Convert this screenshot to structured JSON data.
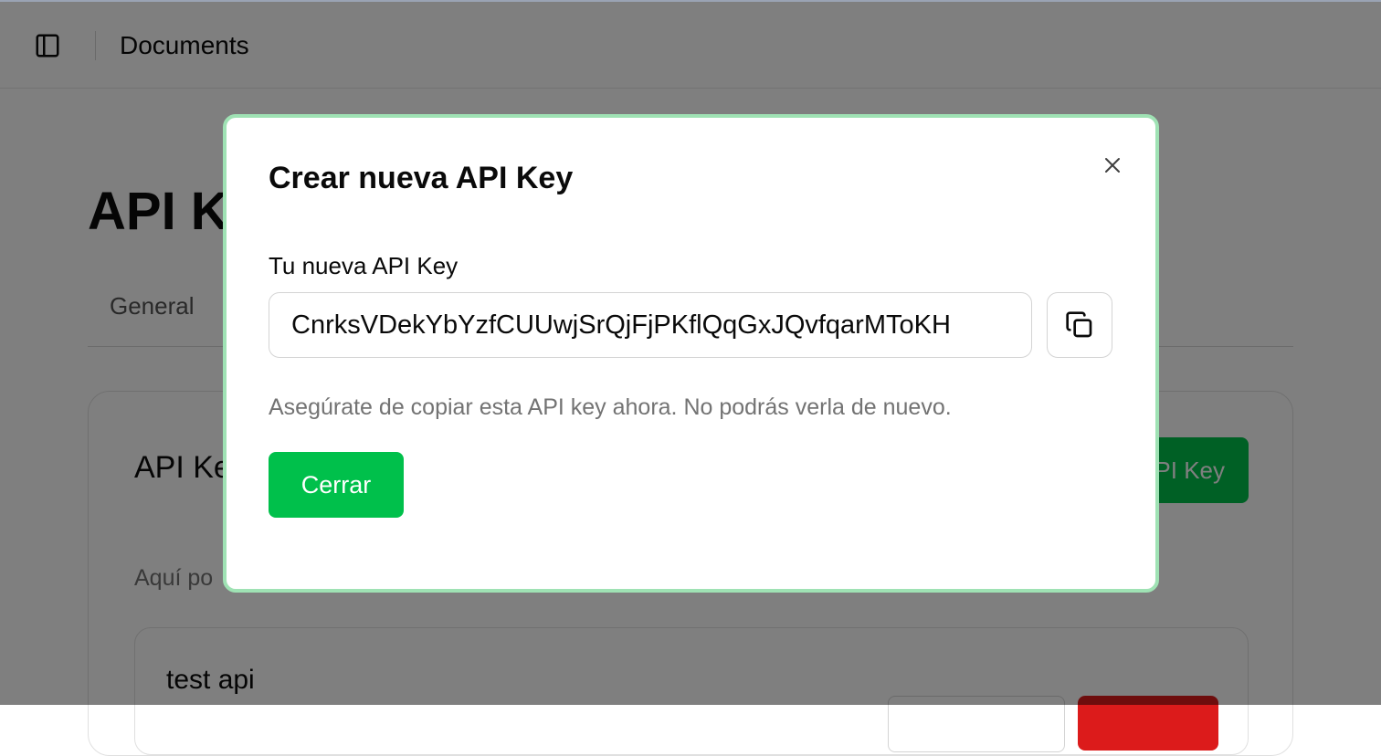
{
  "topbar": {
    "title": "Documents",
    "toggle_icon": "sidebar-panel-icon"
  },
  "page": {
    "title": "API K",
    "tabs": [
      {
        "label": "General"
      }
    ],
    "card": {
      "title": "API Ke",
      "create_button_label": "PI Key",
      "description": "Aquí po",
      "keys": [
        {
          "name": "test api"
        }
      ]
    }
  },
  "dialog": {
    "title": "Crear nueva API Key",
    "field_label": "Tu nueva API Key",
    "api_key": "CnrksVDekYbYzfCUUwjSrQjFjPKflQqGxJQvfqarMToKH",
    "warning": "Asegúrate de copiar esta API key ahora. No podrás verla de nuevo.",
    "close_button_label": "Cerrar",
    "close_icon": "close-icon",
    "copy_icon": "copy-icon"
  },
  "colors": {
    "accent": "#00c04b",
    "danger": "#dc1b1b",
    "dialog_border": "#9fe2b4",
    "overlay": "rgba(0,0,0,0.5)"
  }
}
